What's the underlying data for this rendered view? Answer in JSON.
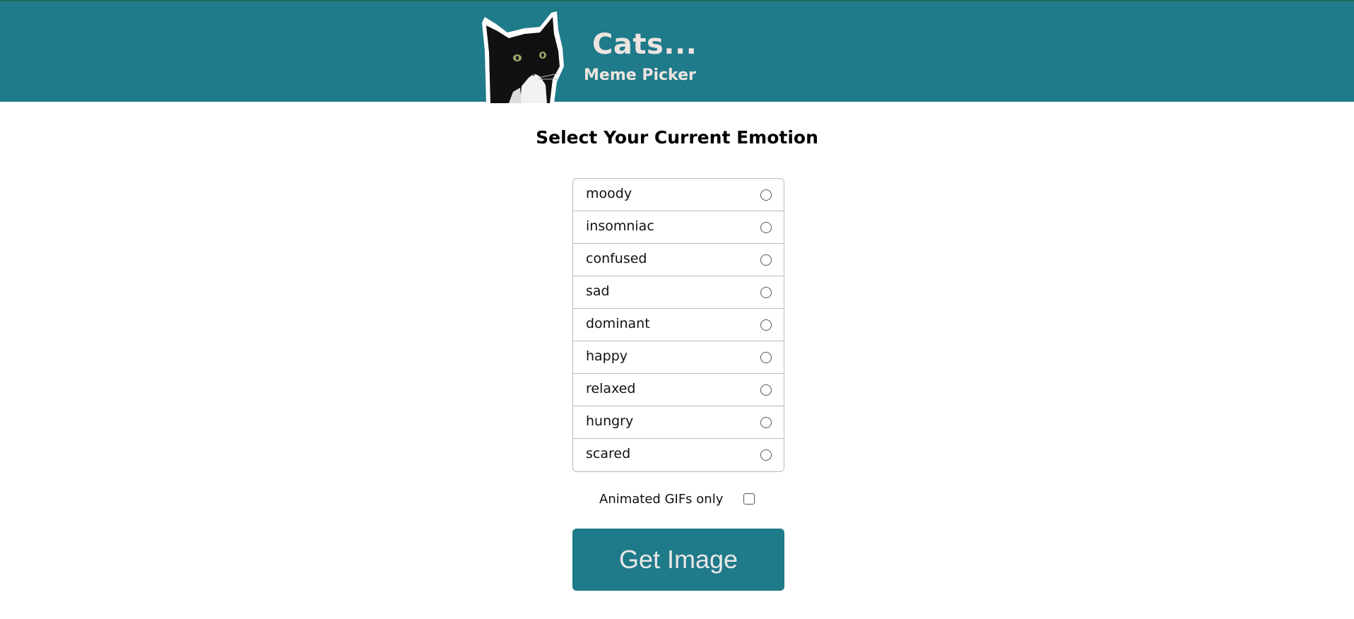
{
  "header": {
    "title": "Cats...",
    "subtitle": "Meme Picker",
    "logo_icon": "cat-photo-icon",
    "background_color": "#1f7a8a",
    "text_color": "#ece4df"
  },
  "main": {
    "heading": "Select Your Current Emotion",
    "emotions": [
      {
        "label": "moody",
        "selected": false
      },
      {
        "label": "insomniac",
        "selected": false
      },
      {
        "label": "confused",
        "selected": false
      },
      {
        "label": "sad",
        "selected": false
      },
      {
        "label": "dominant",
        "selected": false
      },
      {
        "label": "happy",
        "selected": false
      },
      {
        "label": "relaxed",
        "selected": false
      },
      {
        "label": "hungry",
        "selected": false
      },
      {
        "label": "scared",
        "selected": false
      }
    ],
    "gifs_only_label": "Animated GIFs only",
    "gifs_only_checked": false,
    "button_label": "Get Image",
    "accent_color": "#1f7a8a"
  }
}
